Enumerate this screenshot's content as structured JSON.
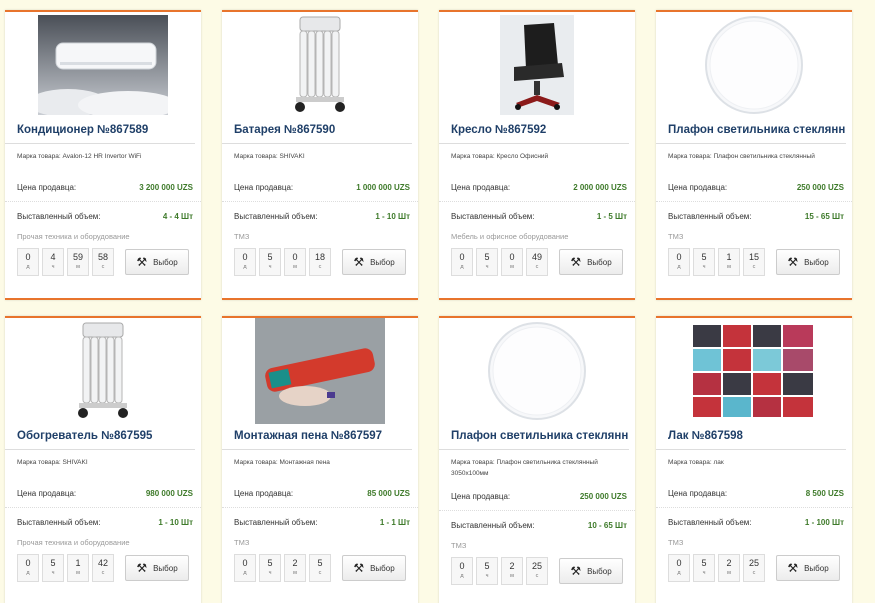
{
  "labels": {
    "price": "Цена продавца:",
    "volume": "Выставленный объем:",
    "bid_button": "Выбор",
    "units": [
      "д",
      "ч",
      "м",
      "с"
    ]
  },
  "products": [
    {
      "title": "Кондиционер №867589",
      "brand": "Марка товара: Avalon-12 HR Invertor WiFi",
      "price": "3 200 000 UZS",
      "volume": "4 - 4 Шт",
      "category": "Прочая техника и оборудование",
      "timer": [
        "0",
        "4",
        "59",
        "58"
      ],
      "image": "air-conditioner"
    },
    {
      "title": "Батарея №867590",
      "brand": "Марка товара: SHIVAKI",
      "price": "1 000 000 UZS",
      "volume": "1 - 10 Шт",
      "category": "ТМЗ",
      "timer": [
        "0",
        "5",
        "0",
        "18"
      ],
      "image": "oil-heater"
    },
    {
      "title": "Кресло №867592",
      "brand": "Марка товара: Кресло Офисний",
      "price": "2 000 000 UZS",
      "volume": "1 - 5 Шт",
      "category": "Мебель и офисное оборудование",
      "timer": [
        "0",
        "5",
        "0",
        "49"
      ],
      "image": "office-chair"
    },
    {
      "title": "Плафон светильника стеклянный",
      "brand": "Марка товара: Плафон светильника стеклянный",
      "price": "250 000 UZS",
      "volume": "15 - 65 Шт",
      "category": "ТМЗ",
      "timer": [
        "0",
        "5",
        "1",
        "15"
      ],
      "image": "lamp-shade"
    },
    {
      "title": "Обогреватель №867595",
      "brand": "Марка товара: SHIVAKI",
      "price": "980 000 UZS",
      "volume": "1 - 10 Шт",
      "category": "Прочая техника и оборудование",
      "timer": [
        "0",
        "5",
        "1",
        "42"
      ],
      "image": "oil-heater"
    },
    {
      "title": "Монтажная пена №867597",
      "brand": "Марка товара: Монтажная пена",
      "price": "85 000 UZS",
      "volume": "1 - 1 Шт",
      "category": "ТМЗ",
      "timer": [
        "0",
        "5",
        "2",
        "5"
      ],
      "image": "foam-can"
    },
    {
      "title": "Плафон светильника стеклянный",
      "brand": "Марка товара: Плафон светильника стеклянный 3050x100мм",
      "price": "250 000 UZS",
      "volume": "10 - 65 Шт",
      "category": "ТМЗ",
      "timer": [
        "0",
        "5",
        "2",
        "25"
      ],
      "image": "lamp-shade"
    },
    {
      "title": "Лак №867598",
      "brand": "Марка товара: лак",
      "price": "8 500 UZS",
      "volume": "1 - 100 Шт",
      "category": "ТМЗ",
      "timer": [
        "0",
        "5",
        "2",
        "25"
      ],
      "image": "nail-polish"
    }
  ]
}
